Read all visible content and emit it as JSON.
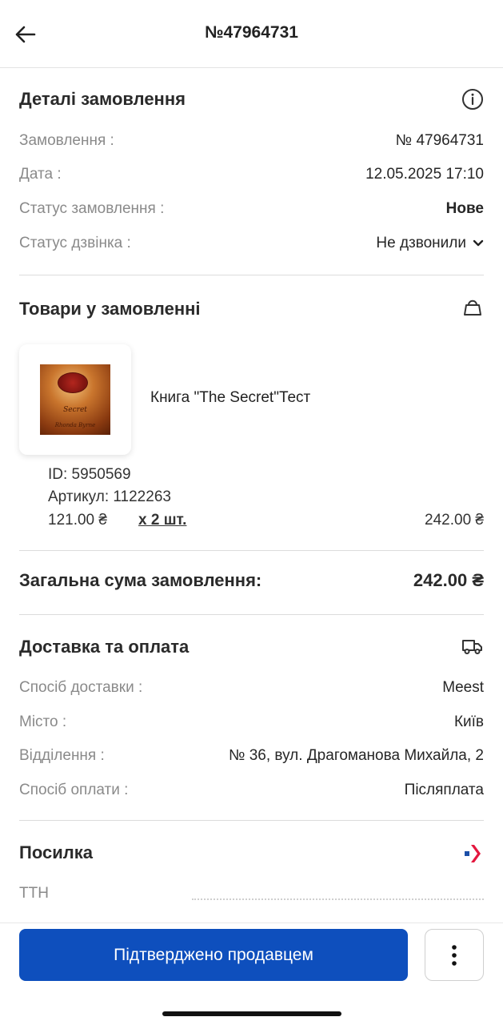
{
  "header": {
    "title": "№47964731"
  },
  "order_details": {
    "title": "Деталі замовлення",
    "rows": [
      {
        "label": "Замовлення :",
        "value": "№ 47964731"
      },
      {
        "label": "Дата :",
        "value": "12.05.2025 17:10"
      },
      {
        "label": "Статус замовлення :",
        "value": "Нове"
      },
      {
        "label": "Статус дзвінка :",
        "value": "Не дзвонили"
      }
    ]
  },
  "products": {
    "title": "Товари у замовленні",
    "items": [
      {
        "name": "Книга \"The Secret\"Тест",
        "cover_title": "Secret",
        "cover_author": "Rhonda Byrne",
        "id": "ID: 5950569",
        "sku": "Артикул: 1122263",
        "price": "121.00 ₴",
        "qty": "x 2 шт.",
        "line_total": "242.00 ₴"
      }
    ]
  },
  "total": {
    "label": "Загальна сума замовлення:",
    "value": "242.00 ₴"
  },
  "delivery": {
    "title": "Доставка та оплата",
    "rows": [
      {
        "label": "Спосіб доставки :",
        "value": "Meest"
      },
      {
        "label": "Місто :",
        "value": "Київ"
      },
      {
        "label": "Відділення :",
        "value": "№ 36, вул. Драгоманова Михайла, 2"
      },
      {
        "label": "Спосіб оплати :",
        "value": "Післяплата"
      }
    ]
  },
  "parcel": {
    "title": "Посилка",
    "ttn_label": "ТТН",
    "ttn_value": ""
  },
  "actions": {
    "confirm_label": "Підтверджено продавцем"
  },
  "colors": {
    "primary": "#0e4fbd",
    "label_gray": "#8a8a8a",
    "meest_blue": "#1b4fa8",
    "meest_red": "#e4173e"
  },
  "icons": {
    "back": "arrow-left-icon",
    "info": "info-icon",
    "bag": "shopping-bag-icon",
    "truck": "truck-icon",
    "meest": "meest-logo-icon",
    "more": "more-vertical-icon"
  }
}
